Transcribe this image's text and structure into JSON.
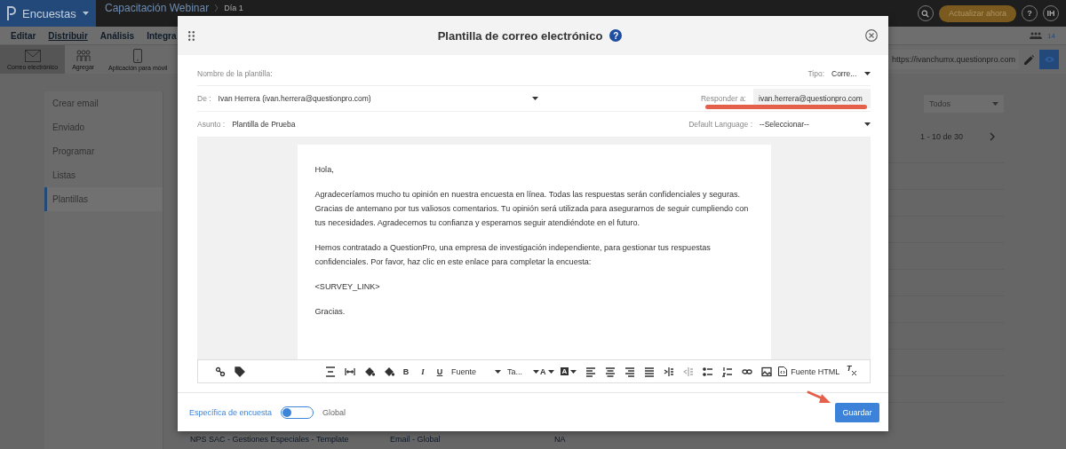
{
  "app_bar": {
    "brand": "Encuestas",
    "breadcrumb": [
      "Capacitación Webinar",
      "Día 1"
    ],
    "upgrade_button": "Actualizar ahora",
    "help_button": "?",
    "avatar": "IH"
  },
  "menu": {
    "tabs": [
      {
        "label": "Editar",
        "selected": false
      },
      {
        "label": "Distribuir",
        "selected": true
      },
      {
        "label": "Análisis",
        "selected": false
      },
      {
        "label": "Integra",
        "selected": false
      }
    ],
    "user_count": "14"
  },
  "channels": {
    "items": [
      {
        "label": "Correo electrónico",
        "kind": "email",
        "selected": true
      },
      {
        "label": "Agregar",
        "kind": "people",
        "selected": false
      },
      {
        "label": "Aplicación para móvil",
        "kind": "mobile",
        "selected": false
      }
    ],
    "url": "https://ivanchumx.questionpro.com"
  },
  "sidebar": {
    "items": [
      {
        "label": "Crear email",
        "selected": false
      },
      {
        "label": "Enviado",
        "selected": false
      },
      {
        "label": "Programar",
        "selected": false
      },
      {
        "label": "Listas",
        "selected": false
      },
      {
        "label": "Plantillas",
        "selected": true
      }
    ]
  },
  "list": {
    "filter": "Todos",
    "pagination": "1 - 10 de 30",
    "visible_row": [
      "NPS SAC - Gestiones Especiales - Template",
      "Email - Global",
      "NA"
    ]
  },
  "dialog": {
    "title": "Plantilla de correo electrónico",
    "title_help": "?",
    "template_name": {
      "label": "Nombre de la plantilla:"
    },
    "type": {
      "label": "Tipo:",
      "value": "Corre..."
    },
    "from": {
      "label": "De :",
      "value": "Ivan Herrera (ivan.herrera@questionpro.com)"
    },
    "reply_to": {
      "label": "Responder a:",
      "value": "ivan.herrera@questionpro.com",
      "highlighted": true
    },
    "subject": {
      "label": "Asunto :",
      "value": "Plantilla de Prueba"
    },
    "language": {
      "label": "Default Language :",
      "value": "--Seleccionar--"
    },
    "body": [
      "Hola,",
      "Agradeceríamos mucho tu opinión en nuestra encuesta en línea. Todas las respuestas serán confidenciales y seguras. Gracias de antemano por tus valiosos comentarios. Tu opinión será utilizada para asegurarnos de seguir cumpliendo con tus necesidades. Agradecemos tu confianza y esperamos seguir atendiéndote en el futuro.",
      "Hemos contratado a QuestionPro, una empresa de investigación independiente, para gestionar tus respuestas confidenciales. Por favor, haz clic en este enlace para completar la encuesta:",
      "<SURVEY_LINK>",
      "Gracias."
    ],
    "editor_toolbar": {
      "bold": "B",
      "italic": "I",
      "underline": "U",
      "font": "Fuente",
      "size": "Ta...",
      "text_color": "A",
      "highlight_color": "A",
      "html_source": "Fuente HTML",
      "clear_format": "T"
    },
    "scope_toggle": {
      "left_label": "Específica de encuesta",
      "right_label": "Global",
      "on": false
    },
    "save_button": "Guardar",
    "save_button_pointed": true
  }
}
